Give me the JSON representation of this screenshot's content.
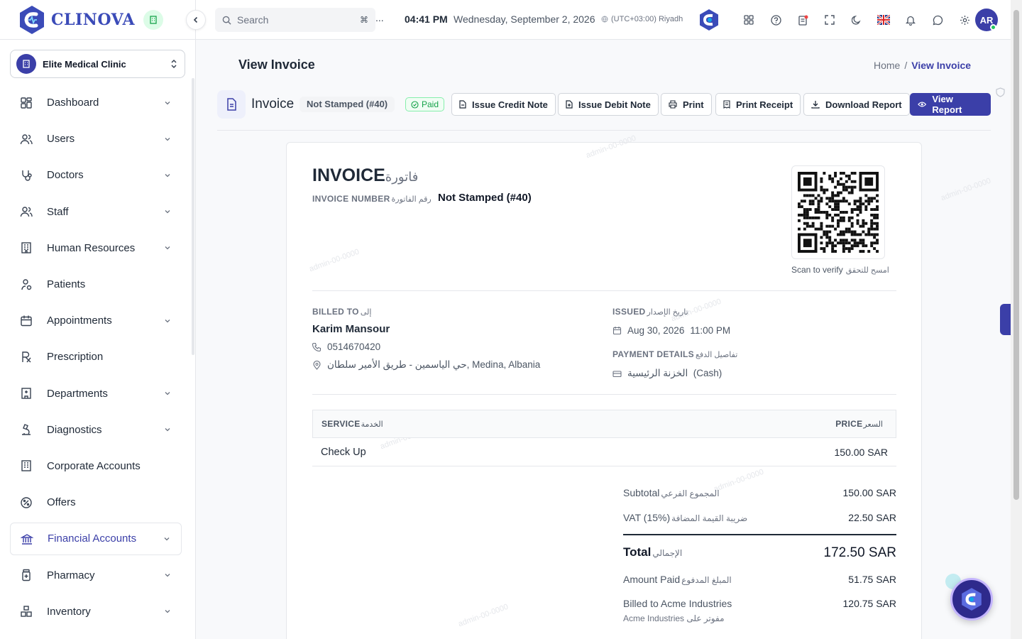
{
  "brand": {
    "name": "CLINOVA"
  },
  "sidebar": {
    "clinic": "Elite Medical Clinic",
    "items": [
      {
        "label": "Dashboard",
        "icon": "dashboard-icon",
        "chevron": true
      },
      {
        "label": "Users",
        "icon": "users-icon",
        "chevron": true
      },
      {
        "label": "Doctors",
        "icon": "stethoscope-icon",
        "chevron": true
      },
      {
        "label": "Staff",
        "icon": "staff-icon",
        "chevron": true
      },
      {
        "label": "Human Resources",
        "icon": "building-icon",
        "chevron": true
      },
      {
        "label": "Patients",
        "icon": "patient-icon",
        "chevron": false
      },
      {
        "label": "Appointments",
        "icon": "calendar-icon",
        "chevron": true
      },
      {
        "label": "Prescription",
        "icon": "rx-icon",
        "chevron": false
      },
      {
        "label": "Departments",
        "icon": "hospital-icon",
        "chevron": true
      },
      {
        "label": "Diagnostics",
        "icon": "microscope-icon",
        "chevron": true
      },
      {
        "label": "Corporate Accounts",
        "icon": "office-icon",
        "chevron": false
      },
      {
        "label": "Offers",
        "icon": "percent-icon",
        "chevron": false
      },
      {
        "label": "Financial Accounts",
        "icon": "bank-icon",
        "chevron": true,
        "active": true
      },
      {
        "label": "Pharmacy",
        "icon": "pill-bottle-icon",
        "chevron": true
      },
      {
        "label": "Inventory",
        "icon": "boxes-icon",
        "chevron": true
      }
    ]
  },
  "header": {
    "search_placeholder": "Search",
    "search_shortcut": "⌘",
    "search_overflow": "...",
    "time": "04:41 PM",
    "date": "Wednesday, September 2, 2026",
    "timezone": "(UTC+03:00) Riyadh",
    "user_initials": "AR"
  },
  "page": {
    "title": "View Invoice",
    "breadcrumb": {
      "home": "Home",
      "sep": "/",
      "current": "View Invoice"
    }
  },
  "toolbar": {
    "doc_label": "Invoice",
    "stamp_badge": "Not Stamped (#40)",
    "status": "Paid",
    "buttons": {
      "credit": "Issue Credit Note",
      "debit": "Issue Debit Note",
      "print": "Print",
      "receipt": "Print Receipt",
      "download": "Download Report",
      "view": "View Report"
    }
  },
  "invoice": {
    "title": "INVOICE",
    "title_ar": "فاتورة",
    "number_label": "INVOICE NUMBER",
    "number_label_ar": "رقم الفاتورة",
    "number": "Not Stamped (#40)",
    "scan_label": "Scan to verify",
    "scan_label_ar": "امسح للتحقق",
    "billed_to_label": "BILLED TO",
    "billed_to_label_ar": "إلى",
    "customer": "Karim Mansour",
    "phone": "0514670420",
    "address": "حي الياسمين - طريق الأمير سلطان, Medina, Albania",
    "issued_label": "ISSUED",
    "issued_label_ar": "تاريخ الإصدار",
    "issued_date": "Aug 30, 2026",
    "issued_time": "11:00 PM",
    "payment_label": "PAYMENT DETAILS",
    "payment_label_ar": "تفاصيل الدفع",
    "payment_method": "الخزنة الرئيسية  (Cash)",
    "table": {
      "col_service": "SERVICE",
      "col_service_ar": "الخدمة",
      "col_price": "PRICE",
      "col_price_ar": "السعر",
      "rows": [
        {
          "service": "Check Up",
          "price": "150.00 SAR"
        }
      ]
    },
    "summary": {
      "subtotal_label": "Subtotal",
      "subtotal_label_ar": "المجموع الفرعي",
      "subtotal": "150.00 SAR",
      "vat_label": "VAT (15%)",
      "vat_label_ar": "ضريبة القيمة المضافة",
      "vat": "22.50 SAR",
      "total_label": "Total",
      "total_label_ar": "الإجمالي",
      "total": "172.50 SAR",
      "paid_label": "Amount Paid",
      "paid_label_ar": "المبلغ المدفوع",
      "paid": "51.75 SAR",
      "billed_label": "Billed to Acme Industries",
      "billed_sub": "Acme Industries مفوتر على",
      "billed": "120.75 SAR"
    }
  },
  "watermark": "admin-00-0000",
  "colors": {
    "primary": "#3b3fa8",
    "success": "#16a34a"
  }
}
